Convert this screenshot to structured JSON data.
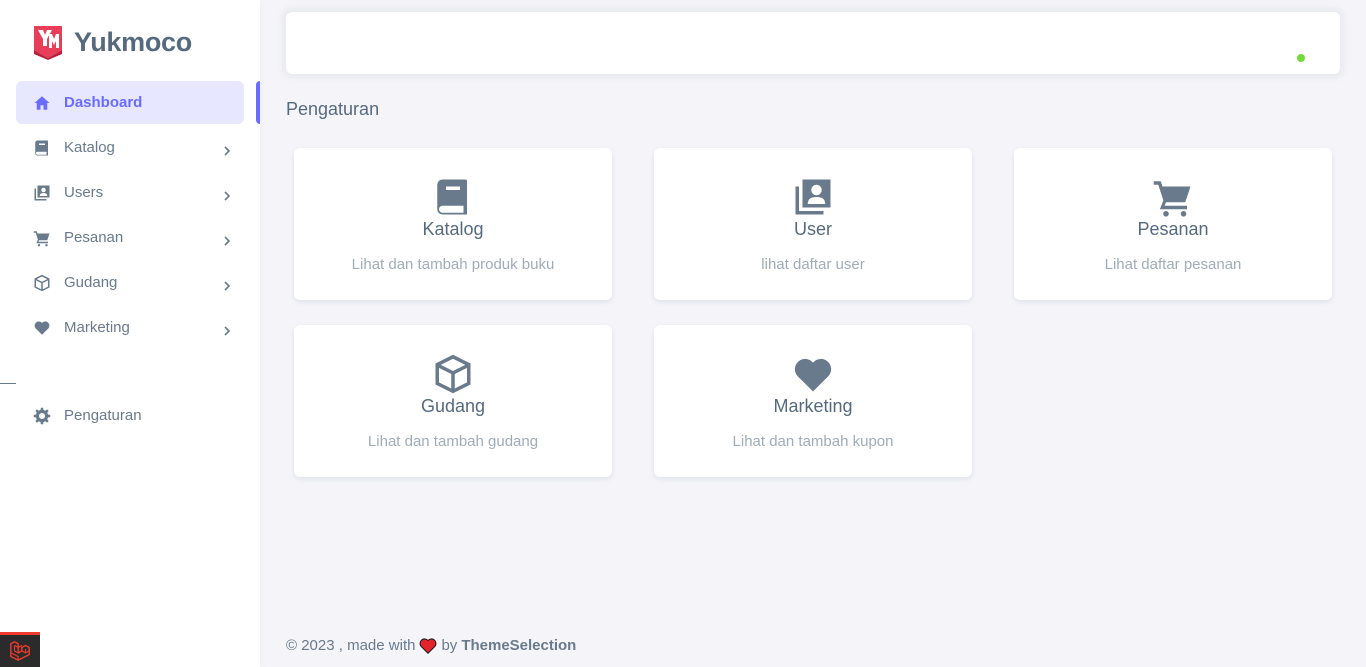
{
  "brand": {
    "name": "Yukmoco"
  },
  "sidebar": {
    "items": [
      {
        "label": "Dashboard",
        "icon": "home-icon",
        "active": true
      },
      {
        "label": "Katalog",
        "icon": "book-icon"
      },
      {
        "label": "Users",
        "icon": "users-icon"
      },
      {
        "label": "Pesanan",
        "icon": "cart-icon"
      },
      {
        "label": "Gudang",
        "icon": "box-icon"
      },
      {
        "label": "Marketing",
        "icon": "heart-icon"
      }
    ],
    "bottom": {
      "label": "Pengaturan",
      "icon": "gear-icon"
    }
  },
  "page": {
    "title": "Pengaturan"
  },
  "cards": [
    {
      "title": "Katalog",
      "desc": "Lihat dan tambah produk buku",
      "icon": "book-icon"
    },
    {
      "title": "User",
      "desc": "lihat daftar user",
      "icon": "users-icon"
    },
    {
      "title": "Pesanan",
      "desc": "Lihat daftar pesanan",
      "icon": "cart-icon"
    },
    {
      "title": "Gudang",
      "desc": "Lihat dan tambah gudang",
      "icon": "box-icon"
    },
    {
      "title": "Marketing",
      "desc": "Lihat dan tambah kupon",
      "icon": "heart-icon"
    }
  ],
  "footer": {
    "prefix": "© 2023 , made with",
    "by": "by",
    "link": "ThemeSelection"
  },
  "colors": {
    "primary": "#696cff",
    "online": "#71dd37",
    "icon": "#697a8d"
  }
}
